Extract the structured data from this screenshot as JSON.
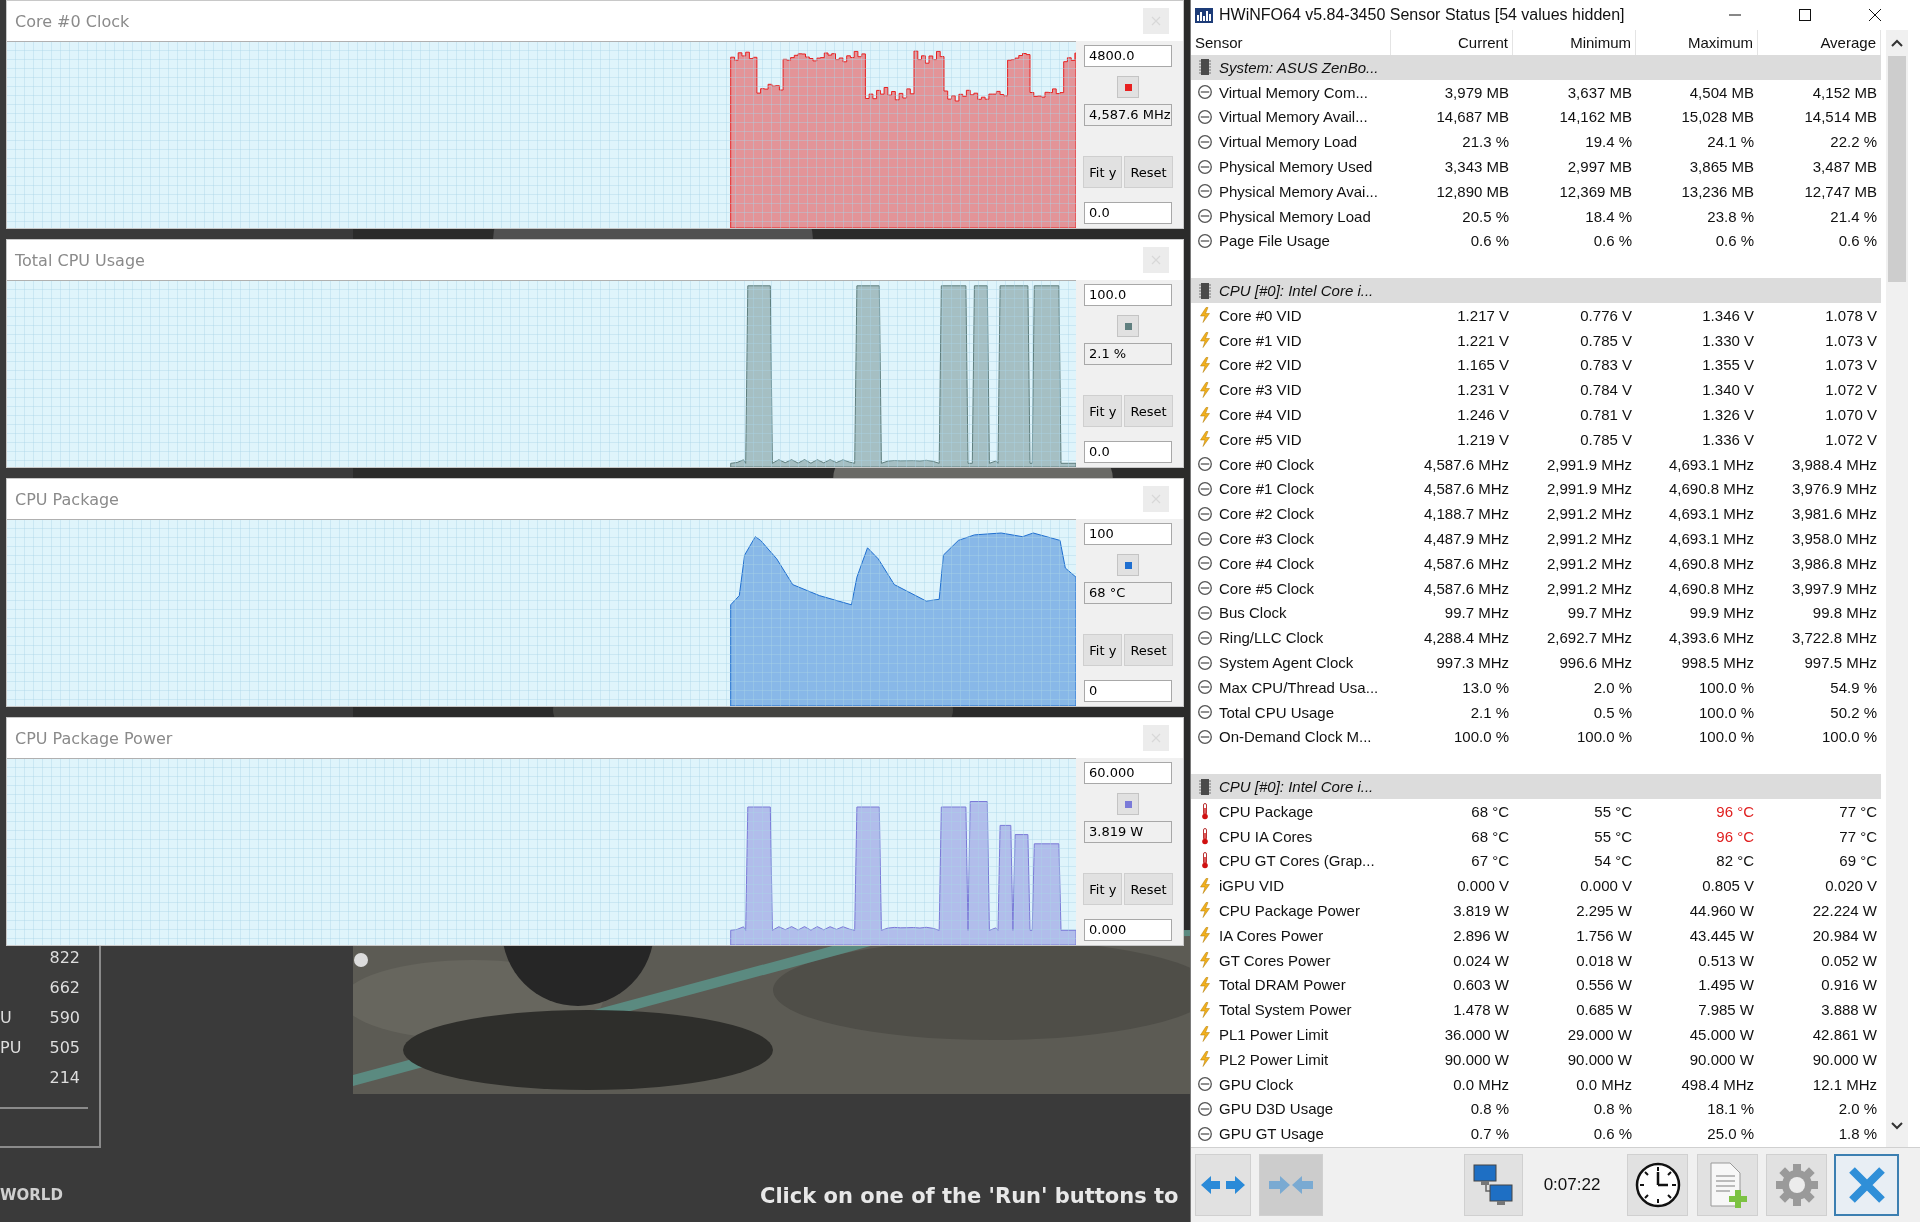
{
  "graph_windows": [
    {
      "title": "Core #0 Clock",
      "max_value": "4800.0",
      "reading": "4,587.6 MHz",
      "min_value": "0.0",
      "color": "#e82020",
      "buttons": [
        "Fit y",
        "Reset"
      ]
    },
    {
      "title": "Total CPU Usage",
      "max_value": "100.0",
      "reading": "2.1 %",
      "min_value": "0.0",
      "color": "#5f7f7f",
      "buttons": [
        "Fit y",
        "Reset"
      ]
    },
    {
      "title": "CPU Package",
      "max_value": "100",
      "reading": "68 °C",
      "min_value": "0",
      "color": "#1f6fd0",
      "buttons": [
        "Fit y",
        "Reset"
      ]
    },
    {
      "title": "CPU Package Power",
      "max_value": "60.000",
      "reading": "3.819 W",
      "min_value": "0.000",
      "color": "#7a7ad8",
      "buttons": [
        "Fit y",
        "Reset"
      ]
    }
  ],
  "benchmark_scores": [
    {
      "score": "822"
    },
    {
      "score": "662"
    },
    {
      "label": "U",
      "score": "590"
    },
    {
      "label": "PU",
      "score": "505"
    },
    {
      "score": "214"
    }
  ],
  "footer_label": "WORLD",
  "status_message": "Click on one of the 'Run' buttons to",
  "hwinfo": {
    "title": "HWiNFO64 v5.84-3450 Sensor Status [54 values hidden]",
    "columns": [
      "Sensor",
      "Current",
      "Minimum",
      "Maximum",
      "Average"
    ],
    "rows": [
      {
        "kind": "group",
        "name": "System: ASUS ZenBo..."
      },
      {
        "kind": "metric",
        "name": "Virtual Memory Com...",
        "values": [
          "3,979 MB",
          "3,637 MB",
          "4,504 MB",
          "4,152 MB"
        ],
        "max_alarm": false
      },
      {
        "kind": "metric",
        "name": "Virtual Memory Avail...",
        "values": [
          "14,687 MB",
          "14,162 MB",
          "15,028 MB",
          "14,514 MB"
        ],
        "max_alarm": false
      },
      {
        "kind": "metric",
        "name": "Virtual Memory Load",
        "values": [
          "21.3 %",
          "19.4 %",
          "24.1 %",
          "22.2 %"
        ],
        "max_alarm": false
      },
      {
        "kind": "metric",
        "name": "Physical Memory Used",
        "values": [
          "3,343 MB",
          "2,997 MB",
          "3,865 MB",
          "3,487 MB"
        ],
        "max_alarm": false
      },
      {
        "kind": "metric",
        "name": "Physical Memory Avai...",
        "values": [
          "12,890 MB",
          "12,369 MB",
          "13,236 MB",
          "12,747 MB"
        ],
        "max_alarm": false
      },
      {
        "kind": "metric",
        "name": "Physical Memory Load",
        "values": [
          "20.5 %",
          "18.4 %",
          "23.8 %",
          "21.4 %"
        ],
        "max_alarm": false
      },
      {
        "kind": "metric",
        "name": "Page File Usage",
        "values": [
          "0.6 %",
          "0.6 %",
          "0.6 %",
          "0.6 %"
        ],
        "max_alarm": false
      },
      {
        "kind": "group",
        "name": "CPU [#0]: Intel Core i..."
      },
      {
        "kind": "voltage",
        "name": "Core #0 VID",
        "values": [
          "1.217 V",
          "0.776 V",
          "1.346 V",
          "1.078 V"
        ],
        "max_alarm": false
      },
      {
        "kind": "voltage",
        "name": "Core #1 VID",
        "values": [
          "1.221 V",
          "0.785 V",
          "1.330 V",
          "1.073 V"
        ],
        "max_alarm": false
      },
      {
        "kind": "voltage",
        "name": "Core #2 VID",
        "values": [
          "1.165 V",
          "0.783 V",
          "1.355 V",
          "1.073 V"
        ],
        "max_alarm": false
      },
      {
        "kind": "voltage",
        "name": "Core #3 VID",
        "values": [
          "1.231 V",
          "0.784 V",
          "1.340 V",
          "1.072 V"
        ],
        "max_alarm": false
      },
      {
        "kind": "voltage",
        "name": "Core #4 VID",
        "values": [
          "1.246 V",
          "0.781 V",
          "1.326 V",
          "1.070 V"
        ],
        "max_alarm": false
      },
      {
        "kind": "voltage",
        "name": "Core #5 VID",
        "values": [
          "1.219 V",
          "0.785 V",
          "1.336 V",
          "1.072 V"
        ],
        "max_alarm": false
      },
      {
        "kind": "metric",
        "name": "Core #0 Clock",
        "values": [
          "4,587.6 MHz",
          "2,991.9 MHz",
          "4,693.1 MHz",
          "3,988.4 MHz"
        ],
        "max_alarm": false
      },
      {
        "kind": "metric",
        "name": "Core #1 Clock",
        "values": [
          "4,587.6 MHz",
          "2,991.9 MHz",
          "4,690.8 MHz",
          "3,976.9 MHz"
        ],
        "max_alarm": false
      },
      {
        "kind": "metric",
        "name": "Core #2 Clock",
        "values": [
          "4,188.7 MHz",
          "2,991.2 MHz",
          "4,693.1 MHz",
          "3,981.6 MHz"
        ],
        "max_alarm": false
      },
      {
        "kind": "metric",
        "name": "Core #3 Clock",
        "values": [
          "4,487.9 MHz",
          "2,991.2 MHz",
          "4,693.1 MHz",
          "3,958.0 MHz"
        ],
        "max_alarm": false
      },
      {
        "kind": "metric",
        "name": "Core #4 Clock",
        "values": [
          "4,587.6 MHz",
          "2,991.2 MHz",
          "4,690.8 MHz",
          "3,986.8 MHz"
        ],
        "max_alarm": false
      },
      {
        "kind": "metric",
        "name": "Core #5 Clock",
        "values": [
          "4,587.6 MHz",
          "2,991.2 MHz",
          "4,690.8 MHz",
          "3,997.9 MHz"
        ],
        "max_alarm": false
      },
      {
        "kind": "metric",
        "name": "Bus Clock",
        "values": [
          "99.7 MHz",
          "99.7 MHz",
          "99.9 MHz",
          "99.8 MHz"
        ],
        "max_alarm": false
      },
      {
        "kind": "metric",
        "name": "Ring/LLC Clock",
        "values": [
          "4,288.4 MHz",
          "2,692.7 MHz",
          "4,393.6 MHz",
          "3,722.8 MHz"
        ],
        "max_alarm": false
      },
      {
        "kind": "metric",
        "name": "System Agent Clock",
        "values": [
          "997.3 MHz",
          "996.6 MHz",
          "998.5 MHz",
          "997.5 MHz"
        ],
        "max_alarm": false
      },
      {
        "kind": "metric",
        "name": "Max CPU/Thread Usa...",
        "values": [
          "13.0 %",
          "2.0 %",
          "100.0 %",
          "54.9 %"
        ],
        "max_alarm": false
      },
      {
        "kind": "metric",
        "name": "Total CPU Usage",
        "values": [
          "2.1 %",
          "0.5 %",
          "100.0 %",
          "50.2 %"
        ],
        "max_alarm": false
      },
      {
        "kind": "metric",
        "name": "On-Demand Clock M...",
        "values": [
          "100.0 %",
          "100.0 %",
          "100.0 %",
          "100.0 %"
        ],
        "max_alarm": false
      },
      {
        "kind": "group",
        "name": "CPU [#0]: Intel Core i..."
      },
      {
        "kind": "temperature",
        "name": "CPU Package",
        "values": [
          "68 °C",
          "55 °C",
          "96 °C",
          "77 °C"
        ],
        "max_alarm": true
      },
      {
        "kind": "temperature",
        "name": "CPU IA Cores",
        "values": [
          "68 °C",
          "55 °C",
          "96 °C",
          "77 °C"
        ],
        "max_alarm": true
      },
      {
        "kind": "temperature",
        "name": "CPU GT Cores (Grap...",
        "values": [
          "67 °C",
          "54 °C",
          "82 °C",
          "69 °C"
        ],
        "max_alarm": false
      },
      {
        "kind": "voltage",
        "name": "iGPU VID",
        "values": [
          "0.000 V",
          "0.000 V",
          "0.805 V",
          "0.020 V"
        ],
        "max_alarm": false
      },
      {
        "kind": "power",
        "name": "CPU Package Power",
        "values": [
          "3.819 W",
          "2.295 W",
          "44.960 W",
          "22.224 W"
        ],
        "max_alarm": false
      },
      {
        "kind": "power",
        "name": "IA Cores Power",
        "values": [
          "2.896 W",
          "1.756 W",
          "43.445 W",
          "20.984 W"
        ],
        "max_alarm": false
      },
      {
        "kind": "power",
        "name": "GT Cores Power",
        "values": [
          "0.024 W",
          "0.018 W",
          "0.513 W",
          "0.052 W"
        ],
        "max_alarm": false
      },
      {
        "kind": "power",
        "name": "Total DRAM Power",
        "values": [
          "0.603 W",
          "0.556 W",
          "1.495 W",
          "0.916 W"
        ],
        "max_alarm": false
      },
      {
        "kind": "power",
        "name": "Total System Power",
        "values": [
          "1.478 W",
          "0.685 W",
          "7.985 W",
          "3.888 W"
        ],
        "max_alarm": false
      },
      {
        "kind": "power",
        "name": "PL1 Power Limit",
        "values": [
          "36.000 W",
          "29.000 W",
          "45.000 W",
          "42.861 W"
        ],
        "max_alarm": false
      },
      {
        "kind": "power",
        "name": "PL2 Power Limit",
        "values": [
          "90.000 W",
          "90.000 W",
          "90.000 W",
          "90.000 W"
        ],
        "max_alarm": false
      },
      {
        "kind": "metric",
        "name": "GPU Clock",
        "values": [
          "0.0 MHz",
          "0.0 MHz",
          "498.4 MHz",
          "12.1 MHz"
        ],
        "max_alarm": false
      },
      {
        "kind": "metric",
        "name": "GPU D3D Usage",
        "values": [
          "0.8 %",
          "0.8 %",
          "18.1 %",
          "2.0 %"
        ],
        "max_alarm": false
      },
      {
        "kind": "metric",
        "name": "GPU GT Usage",
        "values": [
          "0.7 %",
          "0.6 %",
          "25.0 %",
          "1.8 %"
        ],
        "max_alarm": false
      }
    ],
    "toolbar": [
      {
        "kind": "expand",
        "disabled": false,
        "focused": false
      },
      {
        "kind": "collapse",
        "disabled": true,
        "focused": false
      },
      {
        "kind": "network",
        "disabled": false,
        "focused": false
      },
      {
        "kind": "timer",
        "text": "0:07:22"
      },
      {
        "kind": "clock",
        "disabled": false,
        "focused": false
      },
      {
        "kind": "report",
        "disabled": false,
        "focused": false
      },
      {
        "kind": "settings",
        "disabled": false,
        "focused": false
      },
      {
        "kind": "close",
        "disabled": false,
        "focused": true
      }
    ]
  }
}
